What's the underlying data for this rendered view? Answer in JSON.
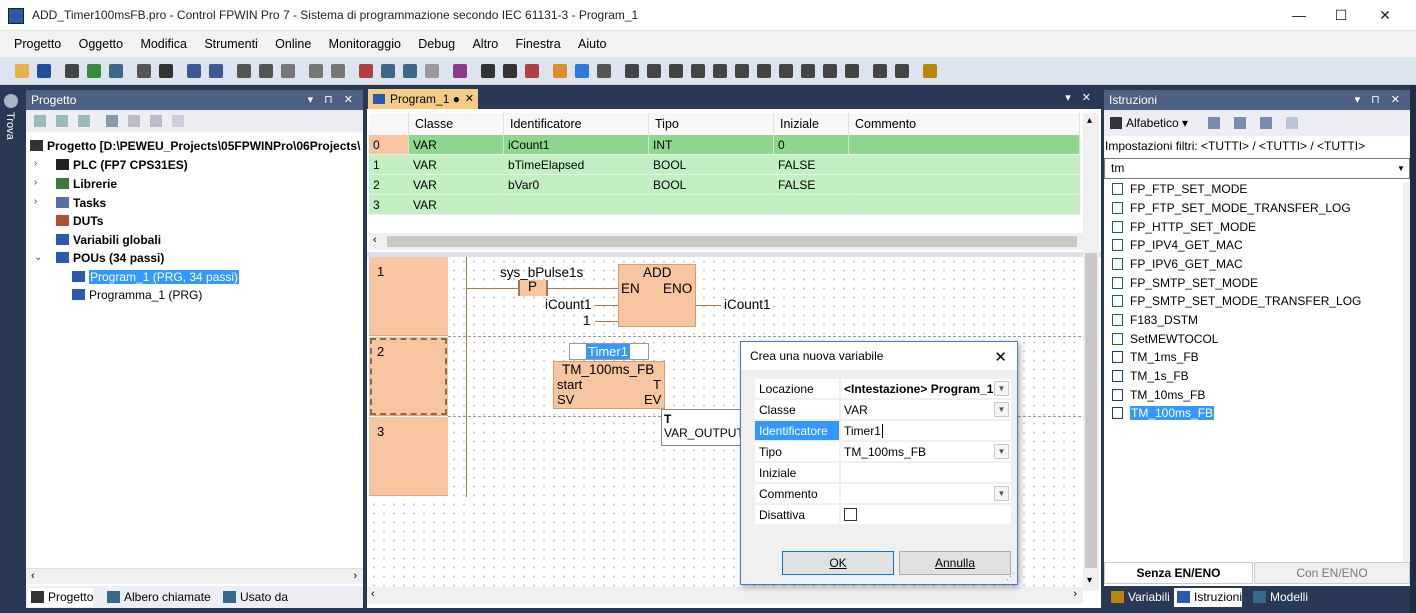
{
  "window": {
    "title": "ADD_Timer100msFB.pro - Control FPWIN Pro 7 - Sistema di programmazione secondo IEC 61131-3 - Program_1",
    "controls": [
      "—",
      "☐",
      "✕"
    ]
  },
  "menu": [
    "Progetto",
    "Oggetto",
    "Modifica",
    "Strumenti",
    "Online",
    "Monitoraggio",
    "Debug",
    "Altro",
    "Finestra",
    "Aiuto"
  ],
  "side_strip": {
    "label": "Trova"
  },
  "project_panel": {
    "title": "Progetto",
    "controls": "▾ ⊓ ✕",
    "root": "Progetto [D:\\PEWEU_Projects\\05FPWINPro\\06Projects\\",
    "nodes": [
      {
        "label": "PLC (FP7 CPS31ES)",
        "bold": true,
        "expander": "›"
      },
      {
        "label": "Librerie",
        "bold": true,
        "expander": "›"
      },
      {
        "label": "Tasks",
        "bold": true,
        "expander": "›"
      },
      {
        "label": "DUTs",
        "bold": true,
        "expander": ""
      },
      {
        "label": "Variabili globali",
        "bold": true,
        "expander": ""
      },
      {
        "label": "POUs (34 passi)",
        "bold": true,
        "expander": "⌄"
      }
    ],
    "pous": [
      {
        "label": "Program_1 (PRG, 34 passi)",
        "selected": true
      },
      {
        "label": "Programma_1 (PRG)",
        "selected": false
      }
    ],
    "tabs": [
      "Progetto",
      "Albero chiamate",
      "Usato da"
    ]
  },
  "editor": {
    "tab_label": "Program_1 ●",
    "tab_close": "✕",
    "header_controls": "▾ ✕",
    "columns": [
      "",
      "Classe",
      "Identificatore",
      "Tipo",
      "Iniziale",
      "Commento"
    ],
    "rows": [
      {
        "idx": "0",
        "classe": "VAR",
        "ident": "iCount1",
        "tipo": "INT",
        "iniziale": "0",
        "commento": ""
      },
      {
        "idx": "1",
        "classe": "VAR",
        "ident": "bTimeElapsed",
        "tipo": "BOOL",
        "iniziale": "FALSE",
        "commento": ""
      },
      {
        "idx": "2",
        "classe": "VAR",
        "ident": "bVar0",
        "tipo": "BOOL",
        "iniziale": "FALSE",
        "commento": ""
      },
      {
        "idx": "3",
        "classe": "VAR",
        "ident": "",
        "tipo": "",
        "iniziale": "",
        "commento": ""
      }
    ],
    "rungs": [
      "1",
      "2",
      "3"
    ],
    "rung1": {
      "contact_var": "sys_bPulse1s",
      "contact_label": "P",
      "fb_name": "ADD",
      "pin_en": "EN",
      "pin_eno": "ENO",
      "in1": "iCount1",
      "in2": "1",
      "out": "iCount1"
    },
    "rung2": {
      "instance": "Timer1",
      "fb_type": "TM_100ms_FB",
      "pin_start": "start",
      "pin_t": "T",
      "pin_sv": "SV",
      "pin_ev": "EV"
    },
    "tooltip": {
      "title": "T",
      "text": "VAR_OUTPUT, I"
    }
  },
  "dialog": {
    "title": "Crea una nuova variabile",
    "close": "✕",
    "fields": [
      {
        "label": "Locazione",
        "value": "<Intestazione> Program_1",
        "dropdown": true
      },
      {
        "label": "Classe",
        "value": "VAR",
        "dropdown": true
      },
      {
        "label": "Identificatore",
        "value": "Timer1",
        "dropdown": false
      },
      {
        "label": "Tipo",
        "value": "TM_100ms_FB",
        "dropdown": true
      },
      {
        "label": "Iniziale",
        "value": "",
        "dropdown": false
      },
      {
        "label": "Commento",
        "value": "",
        "dropdown": true
      }
    ],
    "disabled_label": "Disattiva",
    "ok": "OK",
    "cancel": "Annulla"
  },
  "instructions_panel": {
    "title": "Istruzioni",
    "controls": "▾ ⊓ ✕",
    "sort_label": "Alfabetico",
    "filter_text": "Impostazioni filtri: <TUTTI> / <TUTTI> / <TUTTI>",
    "search_value": "tm",
    "items": [
      {
        "label": "FP_FTP_SET_MODE",
        "kind": "green"
      },
      {
        "label": "FP_FTP_SET_MODE_TRANSFER_LOG",
        "kind": "green"
      },
      {
        "label": "FP_HTTP_SET_MODE",
        "kind": "green"
      },
      {
        "label": "FP_IPV4_GET_MAC",
        "kind": "green"
      },
      {
        "label": "FP_IPV6_GET_MAC",
        "kind": "green"
      },
      {
        "label": "FP_SMTP_SET_MODE",
        "kind": "green"
      },
      {
        "label": "FP_SMTP_SET_MODE_TRANSFER_LOG",
        "kind": "green"
      },
      {
        "label": "F183_DSTM",
        "kind": "green"
      },
      {
        "label": "SetMEWTOCOL",
        "kind": "green"
      },
      {
        "label": "TM_1ms_FB",
        "kind": "blue"
      },
      {
        "label": "TM_1s_FB",
        "kind": "blue"
      },
      {
        "label": "TM_10ms_FB",
        "kind": "blue"
      },
      {
        "label": "TM_100ms_FB",
        "kind": "blue",
        "selected": true
      }
    ],
    "bottom_buttons": [
      "Senza EN/ENO",
      "Con EN/ENO"
    ],
    "tabs": [
      "Variabili",
      "Istruzioni",
      "Modelli"
    ]
  },
  "colors": {
    "chrome_dark": "#293955",
    "panel_header": "#4d6082",
    "var_row_green": "#8fd68f",
    "var_row_light": "#c2f0c2",
    "fb_orange": "#f7c59f",
    "selection": "#3399ff"
  }
}
